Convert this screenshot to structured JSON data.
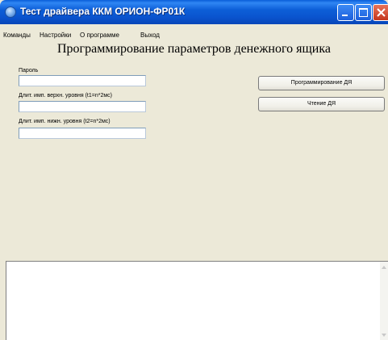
{
  "window": {
    "title": "Тест драйвера ККМ ОРИОН-ФР01К",
    "icon": "app-icon",
    "controls": [
      "minimize-icon",
      "maximize-icon",
      "close-icon"
    ]
  },
  "menu": {
    "items": [
      "Команды",
      "Настройки",
      "О программе",
      "Выход"
    ]
  },
  "main": {
    "heading": "Программирование параметров денежного ящика",
    "fields": [
      {
        "label": "Пароль",
        "value": ""
      },
      {
        "label": "Длит. имп. верхн. уровня (t1=n*2мс)",
        "value": ""
      },
      {
        "label": "Длит. имп. нижн. уровня (t2=n*2мс)",
        "value": ""
      }
    ],
    "buttons": {
      "program": "Программирование ДЯ",
      "read": "Чтение ДЯ"
    }
  },
  "output": {
    "text": ""
  },
  "colors": {
    "titlebar": "#0a54cf",
    "window_bg": "#ece9d8",
    "close_button": "#c4361c"
  }
}
